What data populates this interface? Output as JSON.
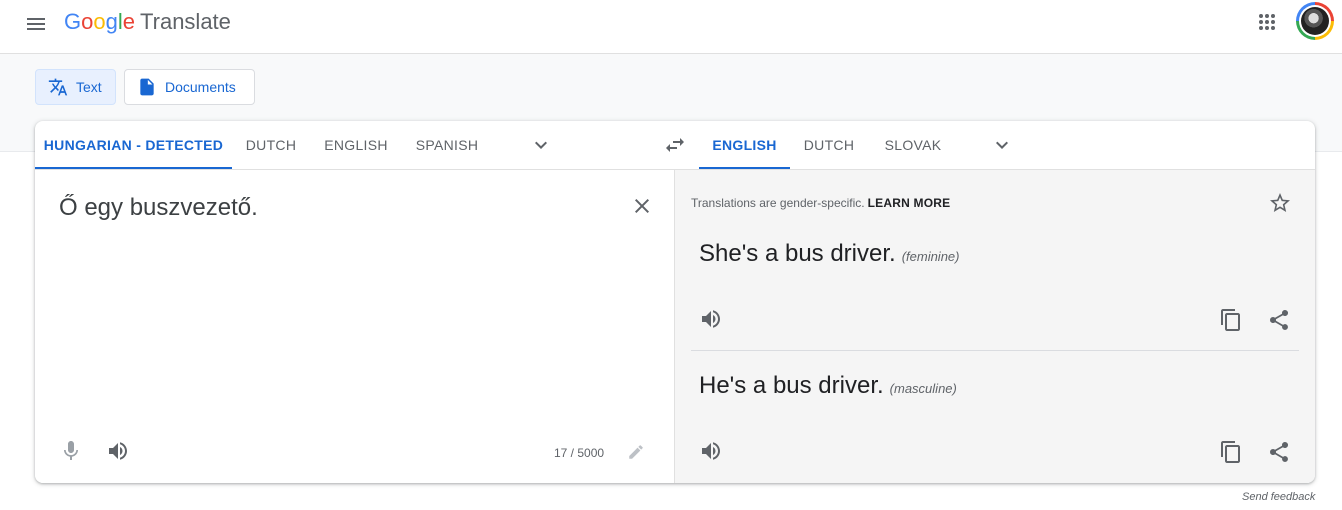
{
  "header": {
    "logo_letters": [
      "G",
      "o",
      "o",
      "g",
      "l",
      "e"
    ],
    "product": "Translate",
    "menu_icon": "hamburger-menu-icon",
    "apps_icon": "apps-grid-icon"
  },
  "modes": {
    "text_label": "Text",
    "documents_label": "Documents"
  },
  "source_langs": [
    "HUNGARIAN - DETECTED",
    "DUTCH",
    "ENGLISH",
    "SPANISH"
  ],
  "target_langs": [
    "ENGLISH",
    "DUTCH",
    "SLOVAK"
  ],
  "source": {
    "text": "Ő egy buszvezető.",
    "char_count": "17 / 5000"
  },
  "target": {
    "notice": "Translations are gender-specific.",
    "learn_more": "LEARN MORE",
    "translations": [
      {
        "text": "She's a bus driver.",
        "gender": "(feminine)"
      },
      {
        "text": "He's a bus driver.",
        "gender": "(masculine)"
      }
    ]
  },
  "footer": {
    "feedback": "Send feedback"
  },
  "colors": {
    "accent": "#1967d2",
    "target_bg": "#f5f5f5",
    "active_mode_bg": "#e8f0fe"
  }
}
